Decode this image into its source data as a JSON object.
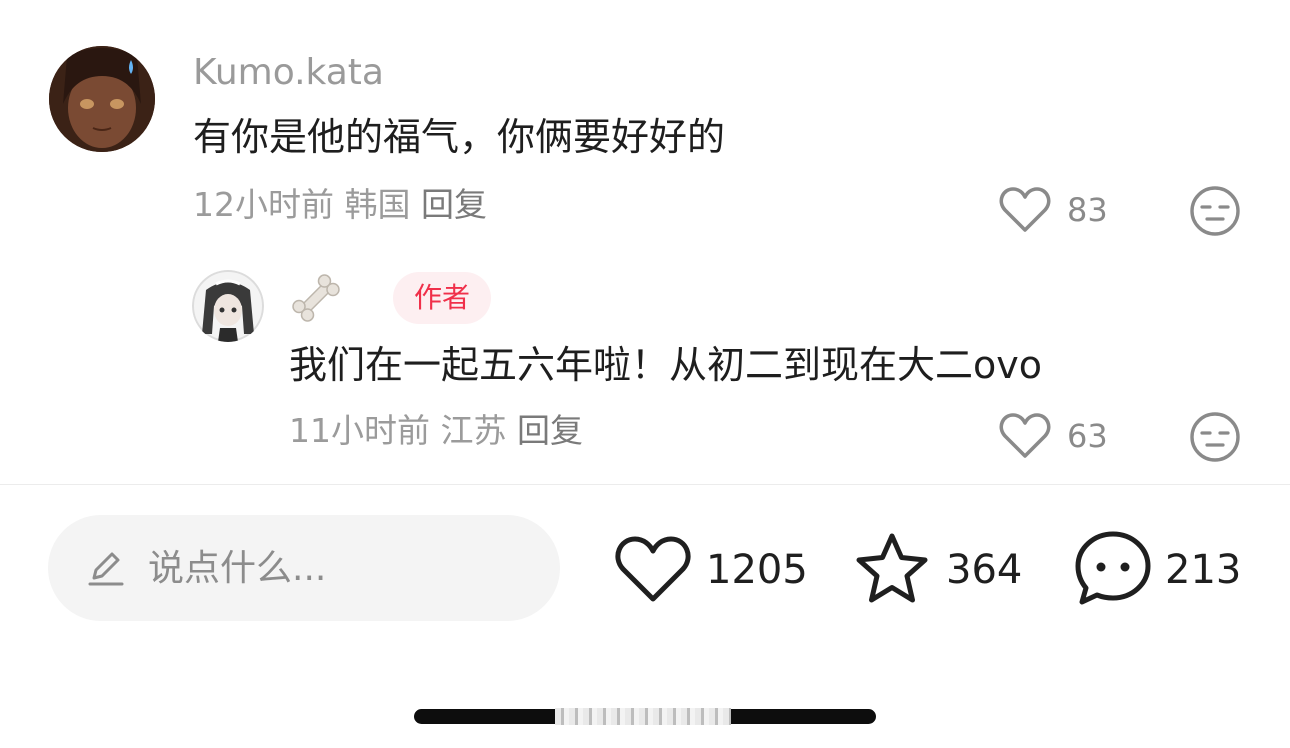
{
  "comment": {
    "username": "Kumo.kata",
    "text": "有你是他的福气，你俩要好好的",
    "time": "12小时前",
    "location": "韩国",
    "reply_label": "回复",
    "like_count": "83"
  },
  "reply": {
    "username_emoji": "bone",
    "author_badge": "作者",
    "text": "我们在一起五六年啦！从初二到现在大二ovo",
    "time": "11小时前",
    "location": "江苏",
    "reply_label": "回复",
    "like_count": "63"
  },
  "bottom_bar": {
    "placeholder": "说点什么...",
    "like_count": "1205",
    "favorite_count": "364",
    "comment_count": "213"
  },
  "icons": {
    "like": "heart-icon",
    "dislike": "neutral-face-icon",
    "edit": "pencil-icon",
    "favorite": "star-icon",
    "comment": "chat-bubble-icon"
  },
  "colors": {
    "author_badge_text": "#f0304a",
    "author_badge_bg": "#fdeff1",
    "meta_text": "#9b9b9b"
  }
}
